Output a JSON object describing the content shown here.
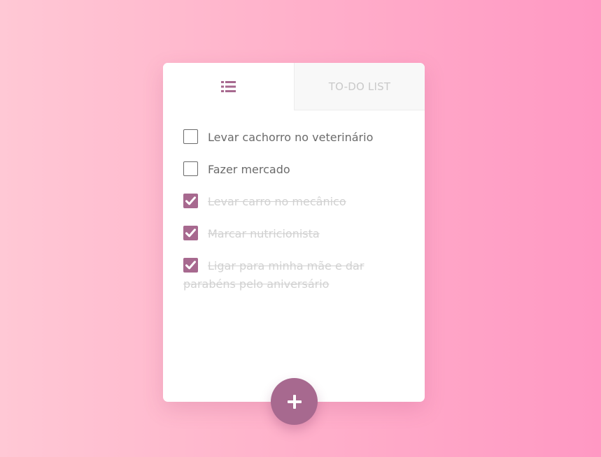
{
  "tabs": {
    "list_icon": "list-icon",
    "title": "TO-DO LIST"
  },
  "todos": [
    {
      "label": "Levar cachorro no veterinário",
      "done": false
    },
    {
      "label": "Fazer mercado",
      "done": false
    },
    {
      "label": "Levar carro no mecânico",
      "done": true
    },
    {
      "label": "Marcar nutricionista",
      "done": true
    },
    {
      "label": "Ligar para minha mãe e dar parabéns pelo aniversário",
      "done": true
    }
  ],
  "add_button": {
    "icon": "plus-icon"
  },
  "colors": {
    "accent": "#a7698f",
    "background_left": "#ffc8d5",
    "background_right": "#ff98c3"
  }
}
